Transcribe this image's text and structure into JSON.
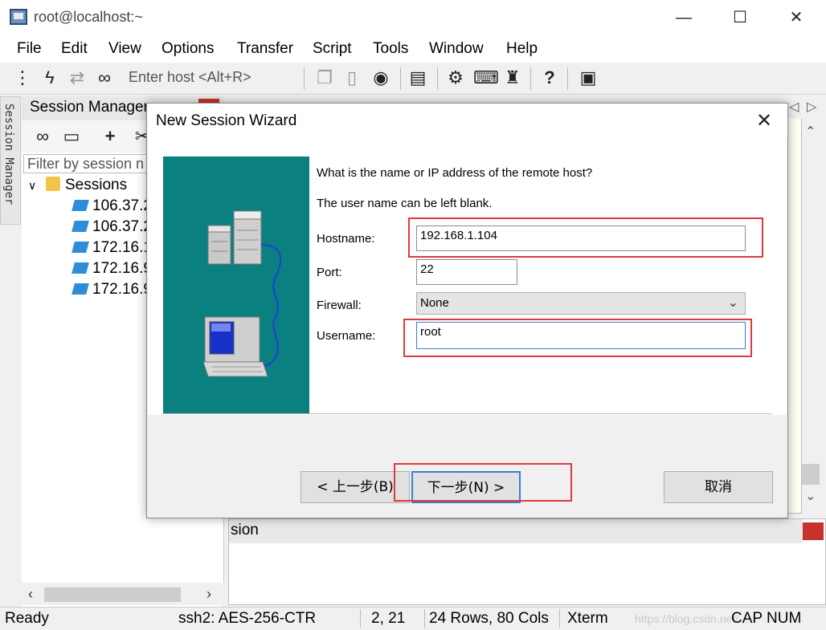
{
  "window": {
    "title": "root@localhost:~"
  },
  "window_controls": {
    "minimize": "—",
    "maximize": "☐",
    "close": "✕"
  },
  "menu": [
    "File",
    "Edit",
    "View",
    "Options",
    "Transfer",
    "Script",
    "Tools",
    "Window",
    "Help"
  ],
  "toolbar": {
    "enter_host": "Enter host <Alt+R>",
    "icons": [
      "connect-icon",
      "lightning-icon",
      "reconnect-icon",
      "link-icon",
      "copy-icon",
      "paste-icon",
      "find-icon",
      "print-icon",
      "settings-icon",
      "keyboard-icon",
      "key-icon",
      "help-icon",
      "sftp-icon"
    ]
  },
  "side_tab": {
    "label": "Session Manager"
  },
  "session_manager": {
    "title": "Session Manager",
    "filter_placeholder": "Filter by session n",
    "root": "Sessions",
    "items": [
      "106.37.2",
      "106.37.2",
      "172.16.1",
      "172.16.9",
      "172.16.9"
    ]
  },
  "command_window": {
    "title": "sion"
  },
  "status_bar": {
    "ready": "Ready",
    "cipher": "ssh2: AES-256-CTR",
    "cursor": "2,  21",
    "size": "24 Rows, 80 Cols",
    "terminal": "Xterm",
    "cap": "CAP",
    "num": "NUM",
    "watermark": "https://blog.csdn.net/..."
  },
  "dialog": {
    "title": "New Session Wizard",
    "close": "✕",
    "question": "What is the name or IP address of the remote host?",
    "hint": "The user name can be left blank.",
    "hostname_label": "Hostname:",
    "hostname_value": "192.168.1.104",
    "port_label": "Port:",
    "port_value": "22",
    "firewall_label": "Firewall:",
    "firewall_value": "None",
    "username_label": "Username:",
    "username_value": "root",
    "back_button": "< 上一步(B)",
    "next_button": "下一步(N) >",
    "cancel_button": "取消",
    "highlight_color": "#e0393e"
  }
}
